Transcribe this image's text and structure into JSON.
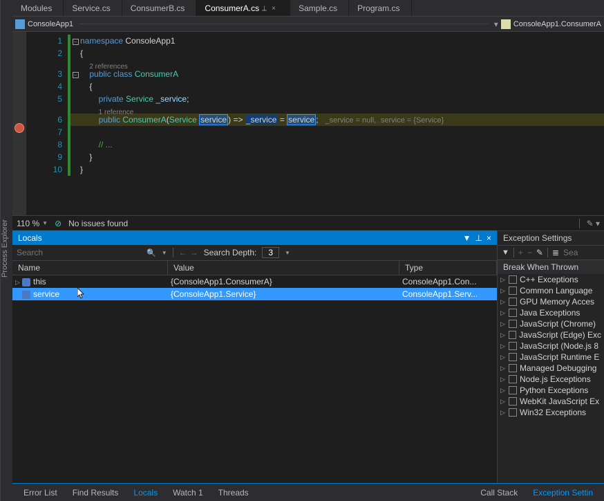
{
  "sidebar_left": "Process Explorer",
  "tabs": [
    {
      "label": "Modules"
    },
    {
      "label": "Service.cs"
    },
    {
      "label": "ConsumerB.cs"
    },
    {
      "label": "ConsumerA.cs",
      "active": true
    },
    {
      "label": "Sample.cs"
    },
    {
      "label": "Program.cs"
    }
  ],
  "nav": {
    "project": "ConsoleApp1",
    "member": "ConsoleApp1.ConsumerA"
  },
  "code": {
    "lines": [
      "1",
      "2",
      "3",
      "4",
      "5",
      "6",
      "7",
      "8",
      "9",
      "10"
    ],
    "ns_kw": "namespace",
    "ns_name": " ConsoleApp1",
    "brace_open": "{",
    "codelens1": "2 references",
    "public_kw": "public",
    "class_kw": " class",
    "class_name": " ConsumerA",
    "private_kw": "private",
    "svc_type": " Service",
    "svc_field": " _service",
    "semi": ";",
    "codelens2": "1 reference",
    "ctor_name": " ConsumerA",
    "paren_open": "(",
    "param_type": "Service ",
    "param_name": "service",
    "paren_close": ")",
    "arrow": " => ",
    "assign_left": "_service",
    "eq": " = ",
    "assign_right": "service",
    "semi2": ";",
    "hint1": "_service = null,",
    "hint2": "service = {Service}",
    "comment": "// ...",
    "brace_close": "}"
  },
  "status": {
    "zoom": "110 %",
    "issues": "No issues found"
  },
  "locals": {
    "title": "Locals",
    "search_ph": "Search",
    "depth_label": "Search Depth:",
    "depth_val": "3",
    "columns": [
      "Name",
      "Value",
      "Type"
    ],
    "rows": [
      {
        "name": "this",
        "value": "{ConsoleApp1.ConsumerA}",
        "type": "ConsoleApp1.Con..."
      },
      {
        "name": "service",
        "value": "{ConsoleApp1.Service}",
        "type": "ConsoleApp1.Serv..."
      }
    ]
  },
  "exceptions": {
    "title": "Exception Settings",
    "search_ph": "Sea",
    "subtitle": "Break When Thrown",
    "items": [
      "C++ Exceptions",
      "Common Language",
      "GPU Memory Acces",
      "Java Exceptions",
      "JavaScript (Chrome)",
      "JavaScript (Edge) Exc",
      "JavaScript (Node.js 8",
      "JavaScript Runtime E",
      "Managed Debugging",
      "Node.js Exceptions",
      "Python Exceptions",
      "WebKit JavaScript Ex",
      "Win32 Exceptions"
    ]
  },
  "bottom_tabs_left": [
    "Error List",
    "Find Results",
    "Locals",
    "Watch 1",
    "Threads"
  ],
  "bottom_tabs_right": [
    "Call Stack",
    "Exception Settin"
  ],
  "bottom_active_left": "Locals",
  "bottom_active_right": "Exception Settin"
}
